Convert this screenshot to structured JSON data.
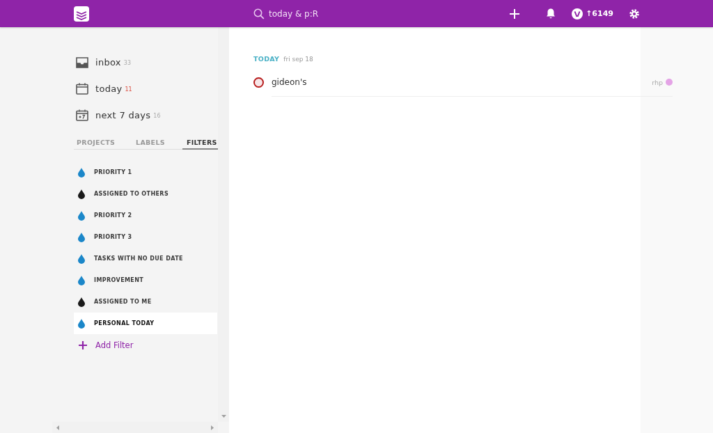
{
  "top_bar": {
    "search": {
      "value": "today & p:R"
    },
    "karma": "↑6149"
  },
  "sidebar": {
    "views": [
      {
        "kind": "inbox",
        "label": "inbox",
        "count": "33",
        "count_highlighted": false
      },
      {
        "kind": "today",
        "label": "today",
        "count": "11",
        "count_highlighted": true
      },
      {
        "kind": "week",
        "label": "next 7 days",
        "count": "16",
        "count_highlighted": false
      }
    ],
    "tabs": [
      {
        "label": "PROJECTS",
        "selected": false
      },
      {
        "label": "LABELS",
        "selected": false
      },
      {
        "label": "FILTERS",
        "selected": true
      }
    ],
    "filters": [
      {
        "label": "PRIORITY 1",
        "color": "#1b87c9",
        "selected": false
      },
      {
        "label": "ASSIGNED TO OTHERS",
        "color": "#1a1a1a",
        "selected": false
      },
      {
        "label": "PRIORITY 2",
        "color": "#1b87c9",
        "selected": false
      },
      {
        "label": "PRIORITY 3",
        "color": "#1b87c9",
        "selected": false
      },
      {
        "label": "TASKS WITH NO DUE DATE",
        "color": "#1b87c9",
        "selected": false
      },
      {
        "label": "IMPROVEMENT",
        "color": "#1b87c9",
        "selected": false
      },
      {
        "label": "ASSIGNED TO ME",
        "color": "#1a1a1a",
        "selected": false
      },
      {
        "label": "PERSONAL TODAY",
        "color": "#1b87c9",
        "selected": true
      }
    ],
    "add_filter": "Add Filter"
  },
  "main": {
    "section": {
      "title": "TODAY",
      "date": "fri sep 18"
    },
    "tasks": [
      {
        "checked": false,
        "title": "gideon's",
        "project": "rhp",
        "color": "#e4a3e6"
      }
    ]
  }
}
